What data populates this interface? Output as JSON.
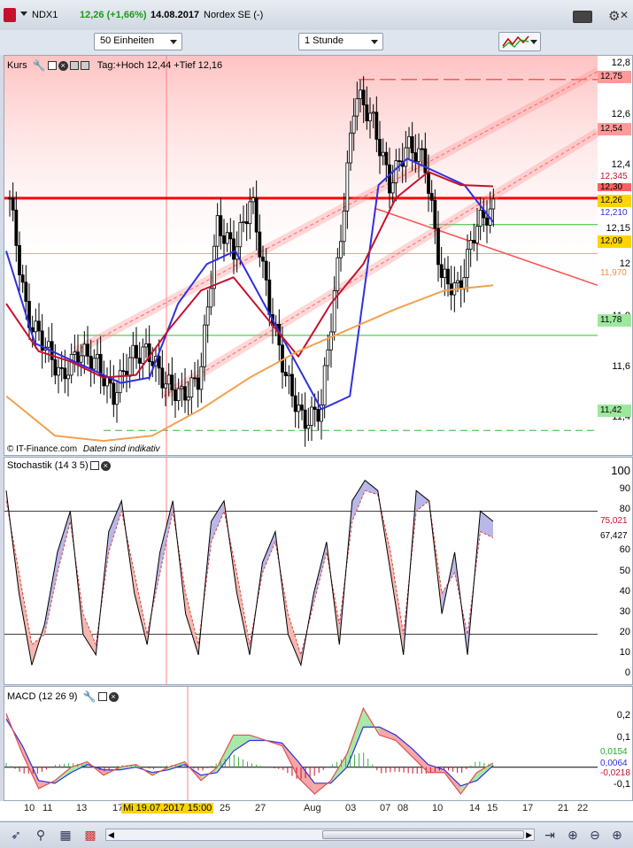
{
  "header": {
    "symbol": "NDX1",
    "price_change": "12,26 (+1,66%)",
    "date": "14.08.2017",
    "exchange": "Nordex SE (-)"
  },
  "toolbar": {
    "units_select": "50 Einheiten",
    "interval_select": "1 Stunde"
  },
  "price_panel": {
    "title": "Kurs",
    "day_info": "Tag:+Hoch 12,44 +Tief 12,16",
    "copyright": "© IT-Finance.com",
    "disclaimer": "Daten sind indikativ",
    "axis_ticks": [
      "12,8",
      "12,6",
      "12,4",
      "12,15",
      "11,8",
      "11,6",
      "12",
      "11,4"
    ],
    "badges": {
      "upper_line": "12,75",
      "resistance_red": "12,54",
      "red_sma": "12,345",
      "bold_red": "12,30",
      "last": "12,26",
      "blue_sma": "12,210",
      "gray_level": "12,09",
      "orange_sma": "11,970",
      "green_mid": "11,78",
      "green_low": "11,42"
    }
  },
  "stoch_panel": {
    "title": "Stochastik (14 3 5)",
    "axis_ticks": [
      "100",
      "90",
      "80",
      "70",
      "60",
      "50",
      "40",
      "30",
      "20",
      "10",
      "0"
    ],
    "badges": {
      "k": "75,021",
      "d": "67,427"
    }
  },
  "macd_panel": {
    "title": "MACD (12 26 9)",
    "axis_ticks": [
      "0,2",
      "0,1",
      "-0,1"
    ],
    "badges": {
      "macd": "0,0154",
      "signal": "0,0064",
      "hist": "-0,0218"
    }
  },
  "x_axis": {
    "labels": [
      "10",
      "11",
      "13",
      "17",
      "25",
      "27",
      "Aug",
      "03",
      "07",
      "08",
      "10",
      "14",
      "15",
      "17",
      "21",
      "22"
    ],
    "cursor_label": "Mi 19.07.2017 15:00"
  },
  "colors": {
    "red_line": "#ff0000",
    "blue_sma": "#3030e0",
    "dark_red_sma": "#c8102e",
    "orange_sma": "#f5a050",
    "green_line": "#33bb33",
    "last_badge": "#ffd400"
  },
  "chart_data": [
    {
      "type": "candlestick",
      "title": "Kurs",
      "ylim": [
        11.32,
        12.84
      ],
      "sample_closes": [
        12.3,
        11.85,
        11.75,
        11.62,
        11.72,
        11.68,
        11.55,
        11.7,
        11.72,
        11.6,
        11.55,
        11.62,
        12.2,
        12.1,
        12.3,
        11.9,
        11.62,
        11.45,
        11.5,
        12.05,
        12.7,
        12.6,
        12.35,
        12.5,
        12.45,
        12.0,
        11.95,
        12.2,
        12.26
      ],
      "horizontal_lines": [
        12.75,
        12.3,
        12.2,
        11.78,
        11.42
      ],
      "series": [
        {
          "name": "SMA kurz",
          "values": [
            12.1,
            11.75,
            11.7,
            11.65,
            11.6,
            11.62,
            11.9,
            12.05,
            12.1,
            11.9,
            11.7,
            11.5,
            11.55,
            12.35,
            12.45,
            12.4,
            12.35,
            12.21
          ]
        },
        {
          "name": "SMA mittel",
          "values": [
            11.9,
            11.72,
            11.68,
            11.62,
            11.63,
            11.8,
            11.95,
            12.0,
            11.85,
            11.7,
            11.9,
            12.05,
            12.3,
            12.4,
            12.35,
            12.345
          ]
        },
        {
          "name": "SMA lang",
          "values": [
            11.55,
            11.4,
            11.38,
            11.4,
            11.5,
            11.62,
            11.72,
            11.8,
            11.88,
            11.95,
            11.97
          ]
        }
      ]
    },
    {
      "type": "line",
      "title": "Stochastik (14 3 5)",
      "ylim": [
        0,
        100
      ],
      "series": [
        {
          "name": "%K",
          "values": [
            90,
            40,
            5,
            25,
            60,
            80,
            20,
            10,
            70,
            85,
            40,
            15,
            60,
            85,
            30,
            10,
            75,
            85,
            40,
            10,
            55,
            70,
            20,
            5,
            40,
            65,
            15,
            85,
            95,
            90,
            50,
            10,
            90,
            85,
            30,
            60,
            10,
            80,
            75
          ]
        },
        {
          "name": "%D",
          "values": [
            85,
            50,
            15,
            20,
            50,
            75,
            30,
            15,
            60,
            80,
            50,
            20,
            50,
            80,
            40,
            15,
            65,
            80,
            50,
            15,
            50,
            65,
            30,
            10,
            35,
            60,
            25,
            75,
            90,
            88,
            60,
            20,
            80,
            85,
            40,
            50,
            20,
            70,
            67
          ]
        }
      ]
    },
    {
      "type": "line",
      "title": "MACD (12 26 9)",
      "ylim": [
        -0.13,
        0.3
      ],
      "series": [
        {
          "name": "MACD",
          "values": [
            0.2,
            0.05,
            -0.08,
            -0.05,
            0.0,
            0.02,
            -0.03,
            0.0,
            0.01,
            -0.03,
            0.0,
            0.02,
            -0.05,
            0.0,
            0.12,
            0.12,
            0.1,
            0.08,
            -0.04,
            -0.1,
            -0.05,
            0.05,
            0.22,
            0.12,
            0.1,
            0.04,
            -0.02,
            -0.02,
            -0.1,
            -0.02,
            0.0154
          ]
        },
        {
          "name": "Signal",
          "values": [
            0.18,
            0.08,
            -0.05,
            -0.06,
            -0.02,
            0.01,
            -0.01,
            -0.01,
            0.0,
            -0.02,
            -0.01,
            0.01,
            -0.03,
            -0.02,
            0.06,
            0.1,
            0.1,
            0.09,
            0.02,
            -0.06,
            -0.06,
            0.0,
            0.15,
            0.15,
            0.12,
            0.07,
            0.01,
            -0.01,
            -0.07,
            -0.05,
            0.0064
          ]
        }
      ]
    }
  ]
}
